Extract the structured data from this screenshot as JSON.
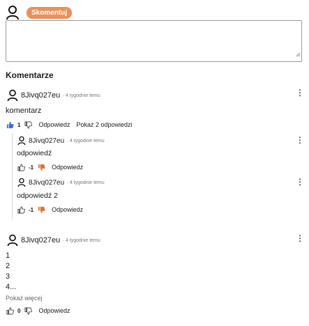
{
  "composer": {
    "submit_label": "Skomentuj",
    "accent_color": "#e8915a"
  },
  "section_title": "Komentarze",
  "comments": [
    {
      "author": "8Jivq027eu",
      "time": "4 tygodnie temu",
      "text": "komentarz",
      "votes": "1",
      "liked": true,
      "reply_label": "Odpowiedz",
      "show_replies_label": "Pokaż 2 odpowiedzi",
      "replies": [
        {
          "author": "8Jivq027eu",
          "time": "4 tygodnie temu",
          "text": "odpowiedź",
          "votes": "-1",
          "disliked": true,
          "reply_label": "Odpowiedz"
        },
        {
          "author": "8Jivq027eu",
          "time": "4 tygodnie temu",
          "text": "odpowiedź 2",
          "votes": "-1",
          "disliked": true,
          "reply_label": "Odpowiedz"
        }
      ]
    },
    {
      "author": "8Jivq027eu",
      "time": "4 tygodnie temu",
      "lines": [
        "1",
        "2",
        "3",
        "4..."
      ],
      "show_more_label": "Pokaż więcej",
      "votes": "0",
      "reply_label": "Odpowiedz"
    }
  ],
  "icons": {
    "avatar": "user-outline-icon",
    "like": "thumb-up-icon",
    "dislike": "thumb-down-icon",
    "menu": "kebab-menu-icon"
  },
  "colors": {
    "like_active": "#3b6fd8",
    "dislike_active": "#d9753a",
    "button_bg": "#e8915a"
  }
}
